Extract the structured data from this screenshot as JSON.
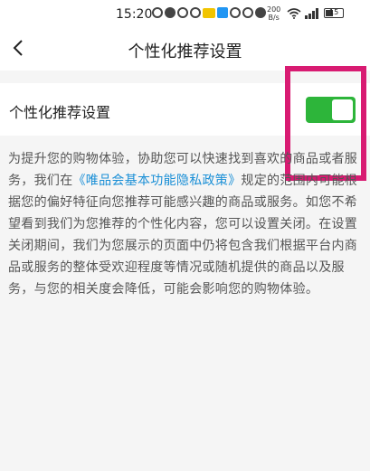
{
  "status_bar": {
    "time": "15:20",
    "net_speed_value": "200",
    "net_speed_unit": "B/s",
    "battery_level": "15"
  },
  "nav": {
    "back_icon": "chevron-left-icon",
    "title": "个性化推荐设置"
  },
  "setting": {
    "label": "个性化推荐设置",
    "toggle_on": true,
    "toggle_color": "#2db53a"
  },
  "highlight_color": "#d81b72",
  "description": {
    "part1": "为提升您的购物体验，协助您可以快速找到喜欢的商品或者服务，我们在",
    "link_text": "《唯品会基本功能隐私政策》",
    "part2": "规定的范围内可能根据您的偏好特征向您推荐可能感兴趣的商品或服务。如您不希望看到我们为您推荐的个性化内容，您可以设置关闭。在设置关闭期间，我们为您展示的页面中仍将包含我们根据平台内商品或服务的整体受欢迎程度等情况或随机提供的商品以及服务，与您的相关度会降低，可能会影响您的购物体验。",
    "link_color": "#1a8fd6"
  }
}
